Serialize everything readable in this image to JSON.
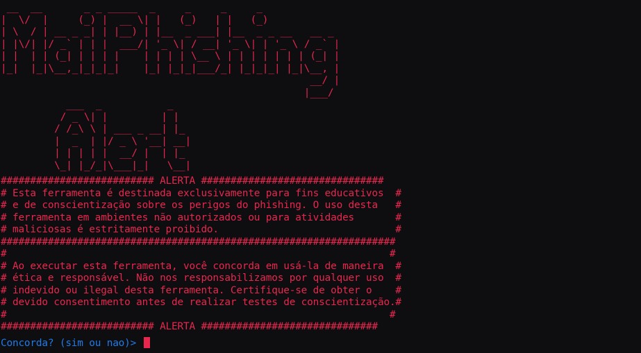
{
  "banner": {
    "ascii_art": " __  __       _ _ _____  _     _     _     _             \n|  \\/  |     (_) |  __ \\| |   (_)   | |   (_)            \n| \\  / | __ _ _| | |__) | |__  _ ___| |__  _ _ __   __ _ \n| |\\/| |/ _` | | |  ___/| '_ \\| / __| '_ \\| | '_ \\ / _` |\n| |  | | (_| | | | |    | | | | \\__ \\ | | | | | | | (_| |\n|_|  |_|\\__,_|_|_|_|    |_| |_|_|___/_| |_|_|_| |_|\\__, |\n                                                    __/ |\n                                                   |___/ \n           ___  _           _   \n          / _ \\| |         | |  \n         / /_\\ \\ | ___ _ __| |_ \n         |  _  | |/ _ \\ '__| __|\n         | | | | |  __/ |  | |_ \n         \\_| |_/_|\\___|_|   \\__|"
  },
  "warning": {
    "lines": [
      "########################## ALERTA ###############################",
      "# Esta ferramenta é destinada exclusivamente para fins educativos  #",
      "# e de conscientização sobre os perigos do phishing. O uso desta   #",
      "# ferramenta em ambientes não autorizados ou para atividades       #",
      "# maliciosas é estritamente proibido.                              #",
      "###################################################################",
      "#                                                                 #",
      "# Ao executar esta ferramenta, você concorda em usá-la de maneira  #",
      "# ética e responsável. Não nos responsabilizamos por qualquer uso  #",
      "# indevido ou ilegal desta ferramenta. Certifique-se de obter o    #",
      "# devido consentimento antes de realizar testes de conscientização.#",
      "#                                                                 #",
      "########################## ALERTA ##############################"
    ]
  },
  "prompt": {
    "text": "Concorda? (sim ou nao)> "
  },
  "colors": {
    "background": "#0e0e11",
    "text_red": "#e8264e",
    "prompt_blue": "#1e7be8"
  }
}
